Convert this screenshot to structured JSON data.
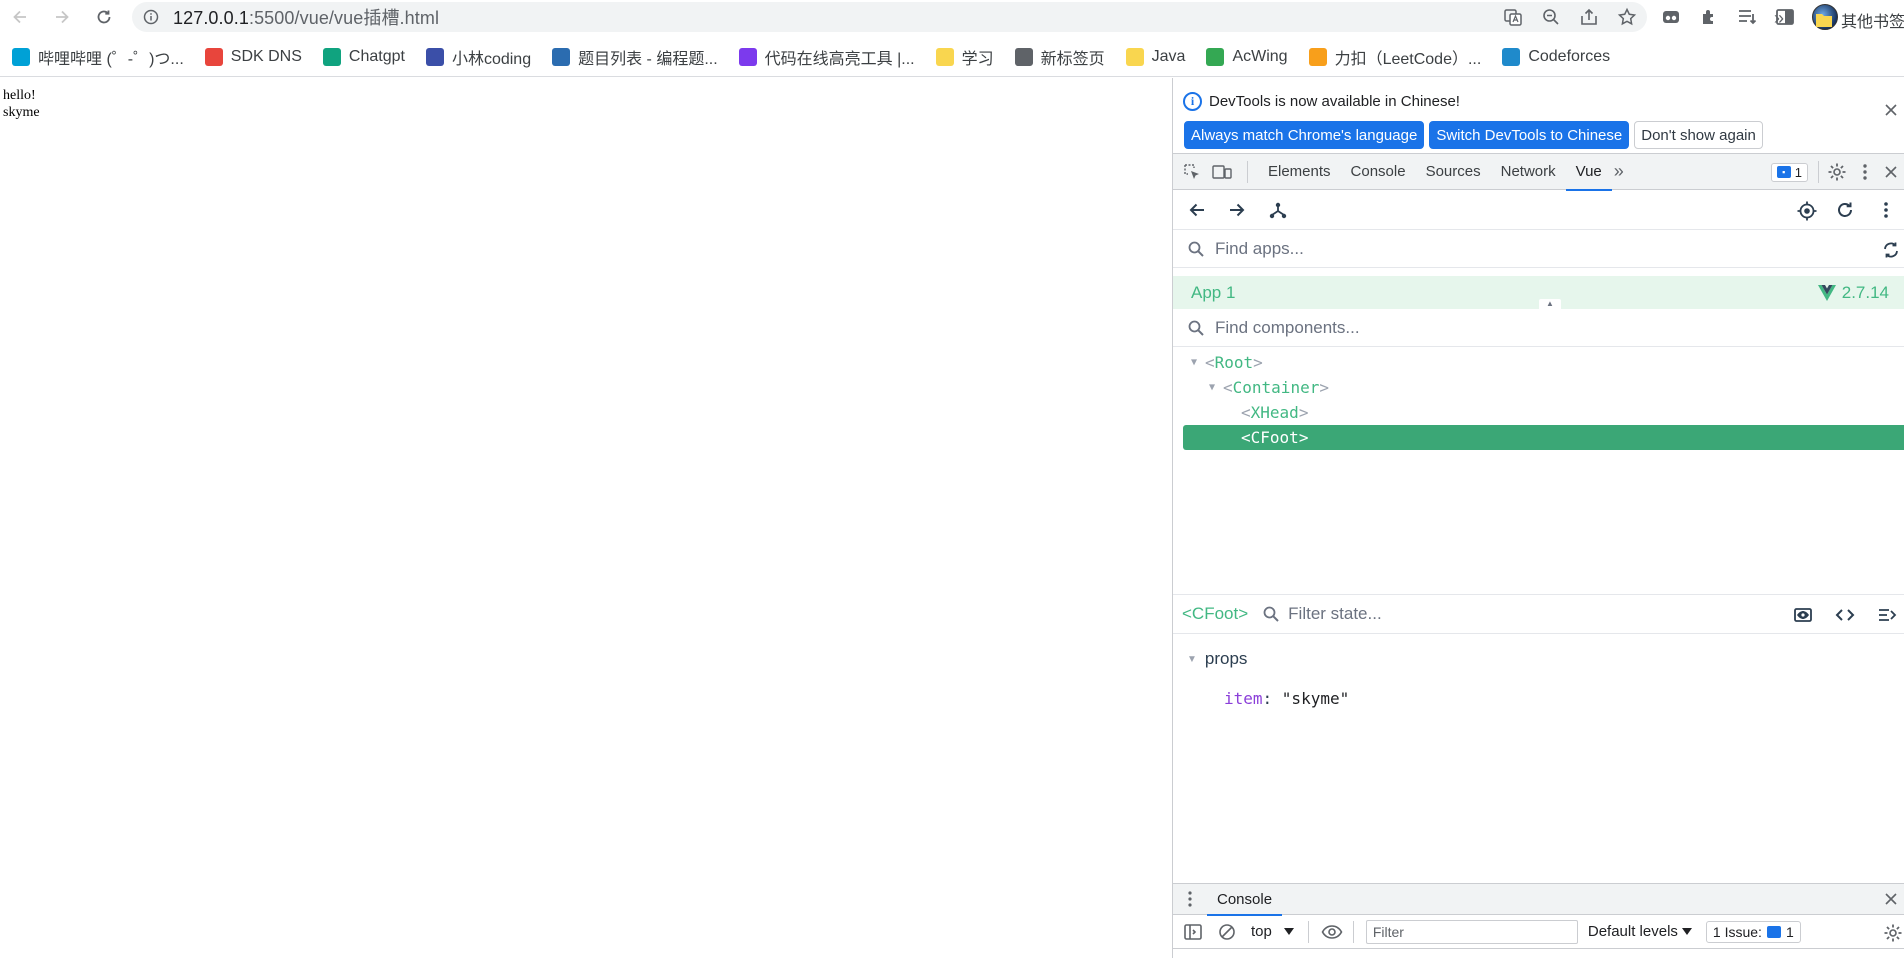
{
  "browser": {
    "url_host": "127.0.0.1",
    "url_path": ":5500/vue/vue插槽.html",
    "bookmarks": [
      {
        "label": "哔哩哔哩 (゜-゜)つ...",
        "color": "#00a1d6"
      },
      {
        "label": "SDK DNS",
        "color": "#e8453c"
      },
      {
        "label": "Chatgpt",
        "color": "#10a37f"
      },
      {
        "label": "小林coding",
        "color": "#3b4fa8"
      },
      {
        "label": "题目列表 - 编程题...",
        "color": "#2b6cb0"
      },
      {
        "label": "代码在线高亮工具 |...",
        "color": "#7c3aed"
      },
      {
        "label": "学习",
        "color": "#f9d64f"
      },
      {
        "label": "新标签页",
        "color": "#5f6368"
      },
      {
        "label": "Java",
        "color": "#f9d64f"
      },
      {
        "label": "AcWing",
        "color": "#34a853"
      },
      {
        "label": "力扣（LeetCode）...",
        "color": "#f89f1b"
      },
      {
        "label": "Codeforces",
        "color": "#1f8acb"
      }
    ],
    "bookmarks_more": "»",
    "other_bookmarks": "其他书签"
  },
  "page": {
    "lines": [
      "hello!",
      "skyme"
    ]
  },
  "devtools": {
    "infobar": {
      "message": "DevTools is now available in Chinese!",
      "btn_match": "Always match Chrome's language",
      "btn_switch": "Switch DevTools to Chinese",
      "btn_dismiss": "Don't show again"
    },
    "tabs": [
      "Elements",
      "Console",
      "Sources",
      "Network",
      "Vue"
    ],
    "issues_count": "1",
    "vue": {
      "find_apps_placeholder": "Find apps...",
      "app_name": "App 1",
      "vue_version": "2.7.14",
      "find_components_placeholder": "Find components...",
      "tree": [
        {
          "name": "Root"
        },
        {
          "name": "Container"
        },
        {
          "name": "XHead"
        },
        {
          "name": "CFoot"
        }
      ],
      "selected_component": "<CFoot>",
      "filter_state_placeholder": "Filter state...",
      "props_title": "props",
      "prop_key": "item",
      "prop_value": "\"skyme\""
    },
    "drawer": {
      "tab": "Console",
      "context": "top",
      "filter_placeholder": "Filter",
      "levels": "Default levels",
      "issues_label": "1 Issue:",
      "issues_count": "1"
    }
  }
}
